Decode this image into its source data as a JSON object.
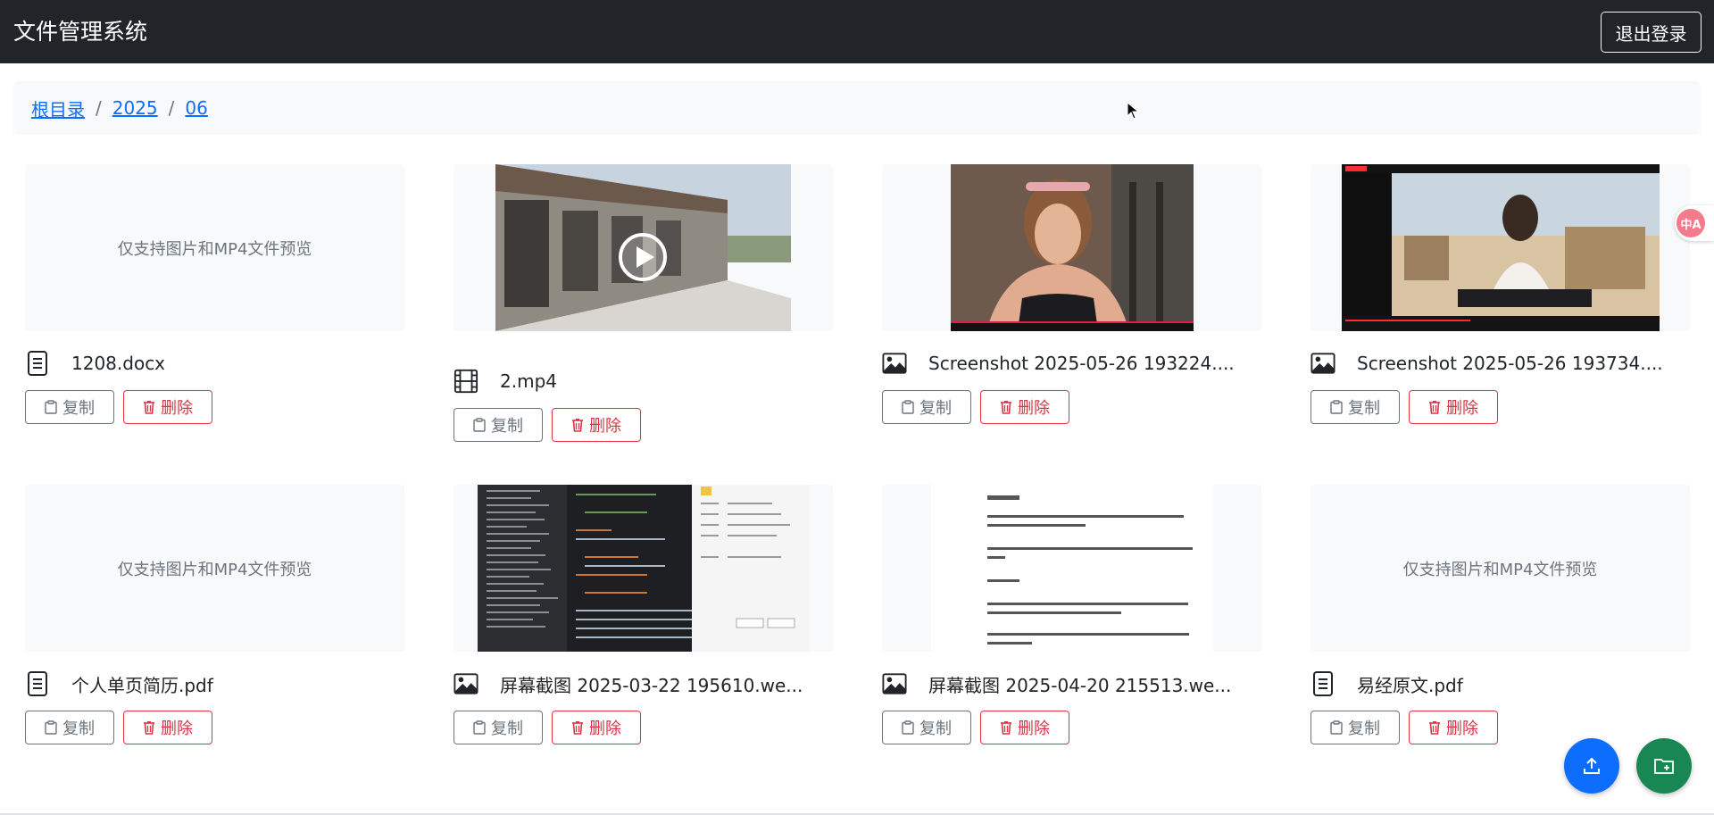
{
  "app": {
    "title": "文件管理系统",
    "logout_label": "退出登录"
  },
  "breadcrumb": [
    "根目录",
    "2025",
    "06"
  ],
  "labels": {
    "copy": "复制",
    "delete": "删除",
    "no_preview": "仅支持图片和MP4文件预览"
  },
  "translate_badge": "中A",
  "files": [
    {
      "name": "1208.docx",
      "type": "document",
      "icon": "file-text-icon",
      "preview": "none"
    },
    {
      "name": "2.mp4",
      "type": "video",
      "icon": "film-icon",
      "preview": "video"
    },
    {
      "name": "Screenshot 2025-05-26 193224....",
      "type": "image",
      "icon": "image-icon",
      "preview": "image"
    },
    {
      "name": "Screenshot 2025-05-26 193734....",
      "type": "image",
      "icon": "image-icon",
      "preview": "image"
    },
    {
      "name": "个人单页简历.pdf",
      "type": "document",
      "icon": "file-text-icon",
      "preview": "none"
    },
    {
      "name": "屏幕截图 2025-03-22 195610.we...",
      "type": "image",
      "icon": "image-icon",
      "preview": "image"
    },
    {
      "name": "屏幕截图 2025-04-20 215513.we...",
      "type": "image",
      "icon": "image-icon",
      "preview": "image"
    },
    {
      "name": "易经原文.pdf",
      "type": "document",
      "icon": "file-text-icon",
      "preview": "none"
    }
  ],
  "colors": {
    "navbar": "#212529",
    "link": "#0d6efd",
    "danger": "#dc3545",
    "secondary": "#6c757d",
    "upload_fab": "#0d6efd",
    "new_folder_fab": "#198754"
  }
}
